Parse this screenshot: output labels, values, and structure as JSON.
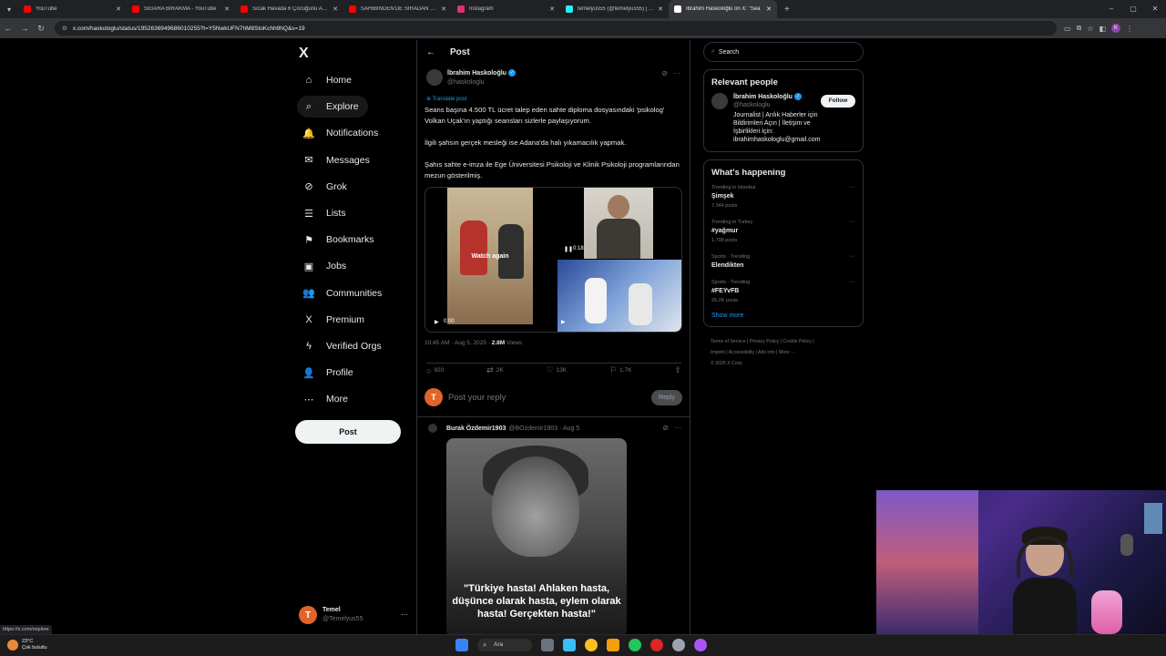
{
  "browser": {
    "tabs": [
      {
        "title": "YouTube",
        "color": "#ff0000",
        "active": false
      },
      {
        "title": "SİGARA BIRAKMA - YouTube",
        "color": "#ff0000",
        "active": false
      },
      {
        "title": "Sıcak Havada 6 Çocuğunu Arab",
        "color": "#ff0000",
        "active": false
      },
      {
        "title": "SAHİBİNDEN'DE SIRADAN BİR",
        "color": "#ff0000",
        "active": false
      },
      {
        "title": "Instagram",
        "color": "#e1306c",
        "active": false
      },
      {
        "title": "temelyus55 (@temelyus55) | Tik",
        "color": "#25f4ee",
        "active": false
      },
      {
        "title": "İbrahim Haskoloğlu on X: \"Sea",
        "color": "#ffffff",
        "active": true
      }
    ],
    "url": "x.com/haskologlu/status/1952636949686010255?t=Y5NwkUFN7hM8StoKchh9hQ&s=19",
    "profile_initial": "K",
    "status_tooltip": "https://x.com/explore"
  },
  "nav": {
    "logo": "X",
    "items": [
      {
        "key": "home",
        "label": "Home",
        "icon": "⌂"
      },
      {
        "key": "explore",
        "label": "Explore",
        "icon": "⌕"
      },
      {
        "key": "notifications",
        "label": "Notifications",
        "icon": "🔔"
      },
      {
        "key": "messages",
        "label": "Messages",
        "icon": "✉"
      },
      {
        "key": "grok",
        "label": "Grok",
        "icon": "⊘"
      },
      {
        "key": "lists",
        "label": "Lists",
        "icon": "☰"
      },
      {
        "key": "bookmarks",
        "label": "Bookmarks",
        "icon": "⚑"
      },
      {
        "key": "jobs",
        "label": "Jobs",
        "icon": "▣"
      },
      {
        "key": "communities",
        "label": "Communities",
        "icon": "👥"
      },
      {
        "key": "premium",
        "label": "Premium",
        "icon": "X"
      },
      {
        "key": "verified",
        "label": "Verified Orgs",
        "icon": "ϟ"
      },
      {
        "key": "profile",
        "label": "Profile",
        "icon": "👤"
      },
      {
        "key": "more",
        "label": "More",
        "icon": "⋯"
      }
    ],
    "post_button": "Post",
    "account": {
      "name": "Temel",
      "handle": "@Temelyus55",
      "initial": "T"
    }
  },
  "post": {
    "header": "Post",
    "author": {
      "name": "İbrahim Haskoloğlu",
      "handle": "@haskologlu"
    },
    "translate": "Translate post",
    "paragraphs": [
      "Seans başına 4.500 TL ücret talep eden sahte diploma dosyasındaki 'psikolog' Volkan Uçak'ın yaptığı seansları sizlerle paylaşıyorum.",
      "İlgili şahsın gerçek mesleği ise Adana'da halı yıkamacılık yapmak.",
      "Şahıs sahte e-imza ile Ege Üniversitesi Psikoloji ve Klinik Psikoloji programlarından mezun gösterilmiş."
    ],
    "media": {
      "watch_again": "Watch again",
      "time1": "0:00",
      "time2": "0:18"
    },
    "time": "10:45 AM · Aug 5, 2025 ·",
    "views_count": "2.8M",
    "views_label": "Views",
    "stats": {
      "replies": "920",
      "reposts": "2K",
      "likes": "13K",
      "bookmarks": "1.7K"
    },
    "reply_placeholder": "Post your reply",
    "reply_button": "Reply"
  },
  "reply": {
    "name": "Burak Özdemir1903",
    "handle": "@BOzdemir1903 · Aug 5",
    "image_text": "\"Türkiye hasta! Ahlaken hasta, düşünce olarak hasta, eylem olarak hasta! Gerçekten hasta!\""
  },
  "right": {
    "search_placeholder": "Search",
    "relevant_title": "Relevant people",
    "person": {
      "name": "İbrahim Haskoloğlu",
      "handle": "@haskologlu",
      "bio": "Journalist | Arılık Haberler için Bildirimleri Açın | İletişim ve İşbirlikleri İçin: ibrahimhaskologlu@gmail.com",
      "follow": "Follow"
    },
    "happening_title": "What's happening",
    "trends": [
      {
        "cat": "Trending in Istanbul",
        "topic": "Şimşek",
        "posts": "7,344 posts"
      },
      {
        "cat": "Trending in Turkey",
        "topic": "#yağmur",
        "posts": "1,798 posts"
      },
      {
        "cat": "Sports · Trending",
        "topic": "Elendikten",
        "posts": ""
      },
      {
        "cat": "Sports · Trending",
        "topic": "#FEYvFB",
        "posts": "26.2K posts"
      }
    ],
    "show_more": "Show more",
    "footer_line1": "Terms of Service  |  Privacy Policy  |  Cookie Policy  |",
    "footer_line2": "Imprint  |  Accessibility  |  Ads info  |  More ···",
    "footer_line3": "© 2025 X Corp."
  },
  "taskbar": {
    "temp": "23°C",
    "weather": "Çok bulutlu",
    "search": "Ara"
  }
}
